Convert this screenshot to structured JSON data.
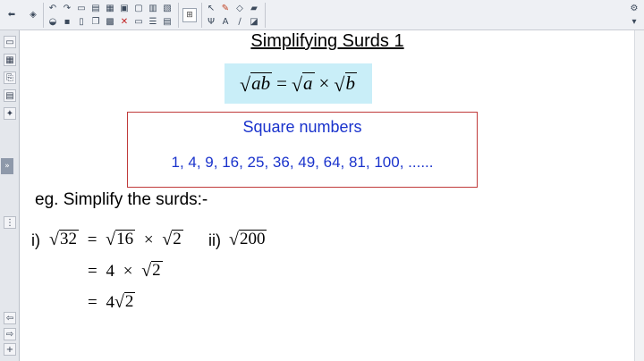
{
  "title": "Simplifying Surds 1",
  "formula": {
    "lhs": "ab",
    "eq": "=",
    "a": "a",
    "times": "×",
    "b": "b"
  },
  "square_numbers": {
    "heading": "Square numbers",
    "list": "1, 4, 9, 16, 25, 36, 49, 64, 81, 100, ......"
  },
  "example": {
    "intro": "eg. Simplify the surds:-",
    "part_i": {
      "label": "i)",
      "step1": {
        "radicand": "32",
        "eq": "=",
        "r1": "16",
        "times": "×",
        "r2": "2"
      },
      "step2": {
        "eq": "=",
        "coef": "4",
        "times": "×",
        "r": "2"
      },
      "step3": {
        "eq": "=",
        "coef": "4",
        "r": "2"
      }
    },
    "part_ii": {
      "label": "ii)",
      "radicand": "200"
    }
  },
  "colors": {
    "accent_blue": "#1a33cc",
    "box_border_red": "#c03a3a",
    "formula_bg": "#c9eef8"
  }
}
